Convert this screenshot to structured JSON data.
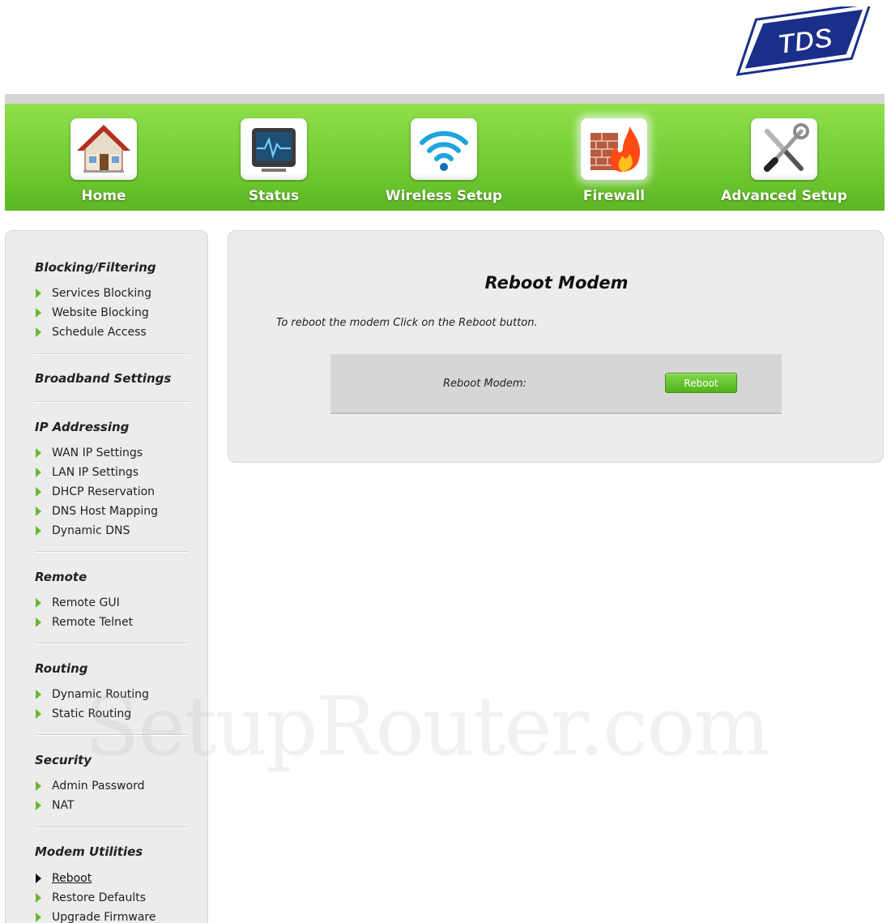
{
  "brand": {
    "logo_text": "TDS",
    "primary_color": "#1a2f8a",
    "accent_color": "#6cc62f"
  },
  "nav": {
    "items": [
      {
        "label": "Home",
        "icon": "house-icon"
      },
      {
        "label": "Status",
        "icon": "monitor-pulse-icon"
      },
      {
        "label": "Wireless Setup",
        "icon": "wifi-icon"
      },
      {
        "label": "Firewall",
        "icon": "firewall-icon",
        "active": true
      },
      {
        "label": "Advanced Setup",
        "icon": "tools-icon"
      }
    ]
  },
  "sidebar": {
    "sections": [
      {
        "title": "Blocking/Filtering",
        "items": [
          "Services Blocking",
          "Website Blocking",
          "Schedule Access"
        ]
      },
      {
        "title": "Broadband Settings",
        "items": []
      },
      {
        "title": "IP Addressing",
        "items": [
          "WAN IP Settings",
          "LAN IP Settings",
          "DHCP Reservation",
          "DNS Host Mapping",
          "Dynamic DNS"
        ]
      },
      {
        "title": "Remote",
        "items": [
          "Remote GUI",
          "Remote Telnet"
        ]
      },
      {
        "title": "Routing",
        "items": [
          "Dynamic Routing",
          "Static Routing"
        ]
      },
      {
        "title": "Security",
        "items": [
          "Admin Password",
          "NAT"
        ]
      },
      {
        "title": "Modem Utilities",
        "items": [
          "Reboot",
          "Restore Defaults",
          "Upgrade Firmware"
        ]
      }
    ],
    "active_item": "Reboot"
  },
  "main": {
    "title": "Reboot Modem",
    "description": "To reboot the modem Click on the Reboot button.",
    "reboot_label": "Reboot Modem:",
    "reboot_button": "Reboot"
  },
  "watermark": "SetupRouter.com"
}
